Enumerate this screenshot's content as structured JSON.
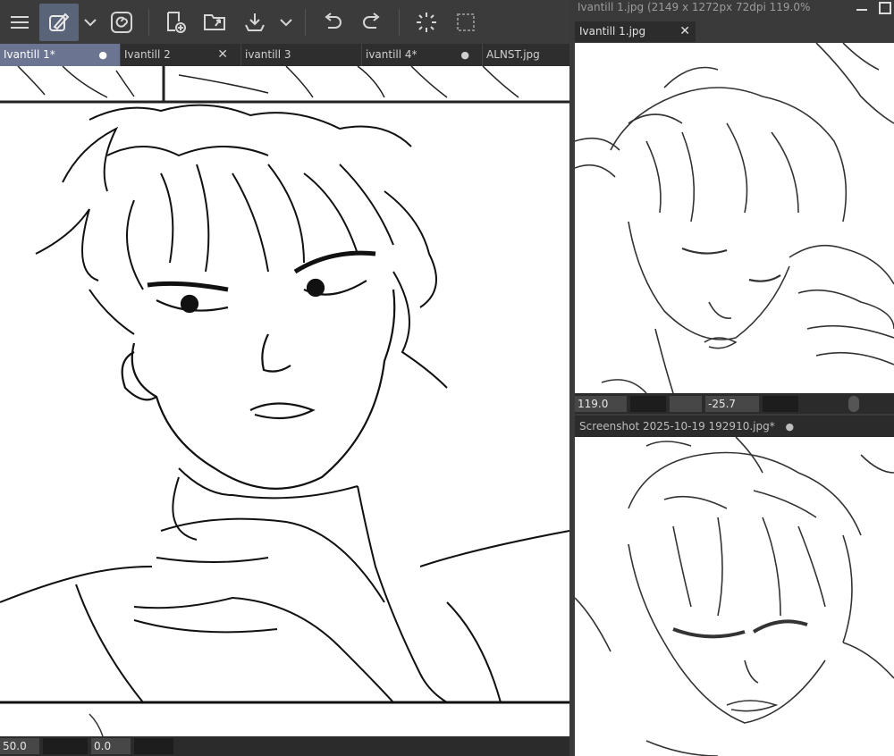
{
  "main": {
    "tabs": [
      {
        "label": "Ivantill 1*",
        "mark": "●",
        "active": true
      },
      {
        "label": "Ivantill 2",
        "mark": "✕"
      },
      {
        "label": "ivantill 3",
        "mark": ""
      },
      {
        "label": "ivantill 4*",
        "mark": "●"
      },
      {
        "label": "ALNST.jpg",
        "mark": ""
      }
    ],
    "status": {
      "zoom": "50.0",
      "angle": "0.0"
    }
  },
  "sub_window_1": {
    "title": "Ivantill 1.jpg (2149 x 1272px 72dpi 119.0%",
    "tab_label": "Ivantill 1.jpg",
    "tab_close": "✕",
    "status": {
      "zoom": "119.0",
      "angle": "-25.7"
    }
  },
  "sub_window_2": {
    "title": "Screenshot 2025-10-19 192910.jpg*",
    "mark": "●"
  },
  "icons": [
    "menu-icon",
    "pen-settings-icon",
    "chevron-down-icon",
    "spiral-icon",
    "new-layer-icon",
    "open-folder-icon",
    "export-icon",
    "undo-icon",
    "redo-icon",
    "loading-icon",
    "selection-icon",
    "minimize-icon",
    "maximize-icon"
  ]
}
